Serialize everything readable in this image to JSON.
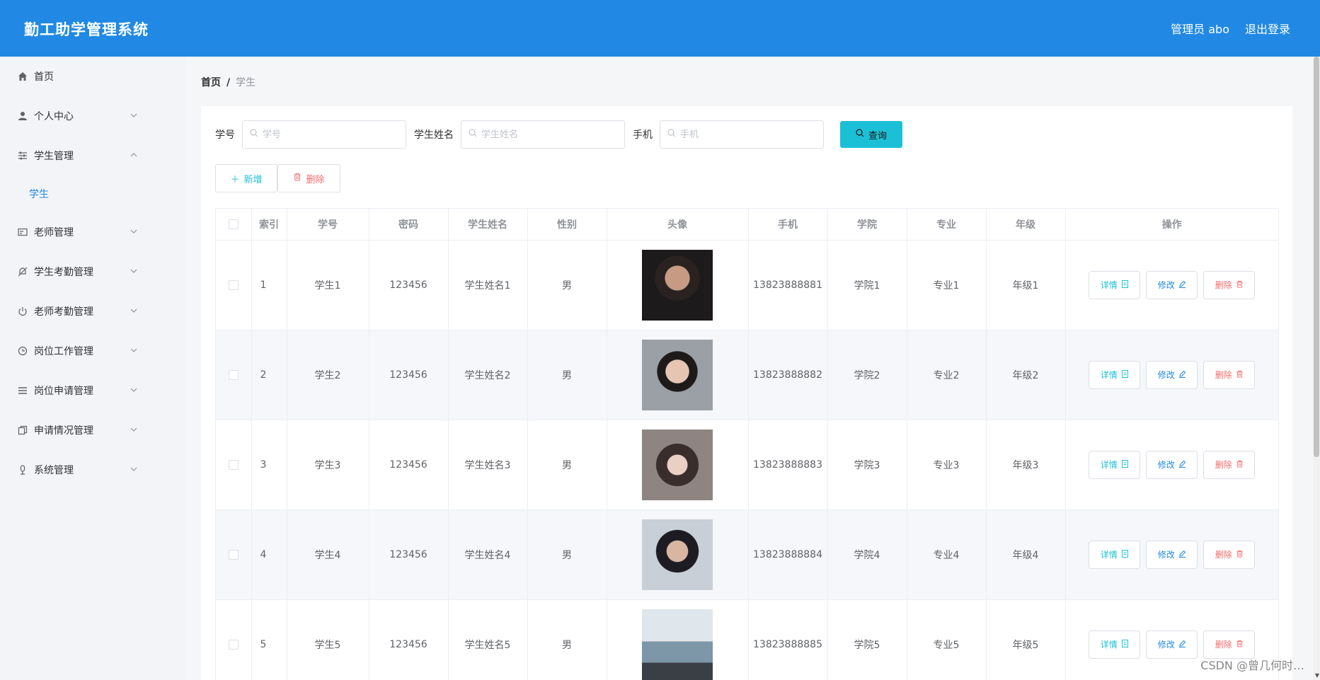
{
  "app": {
    "title": "勤工助学管理系统"
  },
  "header": {
    "user": "管理员 abo",
    "logout": "退出登录"
  },
  "sidebar": {
    "items": [
      {
        "label": "首页",
        "icon": "home-icon",
        "expandable": false
      },
      {
        "label": "个人中心",
        "icon": "user-icon",
        "expandable": true
      },
      {
        "label": "学生管理",
        "icon": "sliders-icon",
        "expandable": true,
        "expanded": true,
        "children": [
          {
            "label": "学生"
          }
        ]
      },
      {
        "label": "老师管理",
        "icon": "card-icon",
        "expandable": true
      },
      {
        "label": "学生考勤管理",
        "icon": "bell-off-icon",
        "expandable": true
      },
      {
        "label": "老师考勤管理",
        "icon": "power-icon",
        "expandable": true
      },
      {
        "label": "岗位工作管理",
        "icon": "clock-icon",
        "expandable": true
      },
      {
        "label": "岗位申请管理",
        "icon": "list-icon",
        "expandable": true
      },
      {
        "label": "申请情况管理",
        "icon": "copy-icon",
        "expandable": true
      },
      {
        "label": "系统管理",
        "icon": "mic-icon",
        "expandable": true
      }
    ]
  },
  "breadcrumb": {
    "home": "首页",
    "sep": "/",
    "current": "学生"
  },
  "search": {
    "fields": [
      {
        "label": "学号",
        "placeholder": "学号"
      },
      {
        "label": "学生姓名",
        "placeholder": "学生姓名"
      },
      {
        "label": "手机",
        "placeholder": "手机"
      }
    ],
    "query_label": "查询"
  },
  "actions": {
    "add_label": "新增",
    "delete_label": "删除"
  },
  "table": {
    "columns": [
      "索引",
      "学号",
      "密码",
      "学生姓名",
      "性别",
      "头像",
      "手机",
      "学院",
      "专业",
      "年级",
      "操作"
    ],
    "rows": [
      {
        "index": "1",
        "id": "学生1",
        "password": "123456",
        "name": "学生姓名1",
        "gender": "男",
        "phone": "13823888881",
        "college": "学院1",
        "major": "专业1",
        "grade": "年级1"
      },
      {
        "index": "2",
        "id": "学生2",
        "password": "123456",
        "name": "学生姓名2",
        "gender": "男",
        "phone": "13823888882",
        "college": "学院2",
        "major": "专业2",
        "grade": "年级2"
      },
      {
        "index": "3",
        "id": "学生3",
        "password": "123456",
        "name": "学生姓名3",
        "gender": "男",
        "phone": "13823888883",
        "college": "学院3",
        "major": "专业3",
        "grade": "年级3"
      },
      {
        "index": "4",
        "id": "学生4",
        "password": "123456",
        "name": "学生姓名4",
        "gender": "男",
        "phone": "13823888884",
        "college": "学院4",
        "major": "专业4",
        "grade": "年级4"
      },
      {
        "index": "5",
        "id": "学生5",
        "password": "123456",
        "name": "学生姓名5",
        "gender": "男",
        "phone": "13823888885",
        "college": "学院5",
        "major": "专业5",
        "grade": "年级5"
      }
    ],
    "row_actions": {
      "detail": "详情",
      "edit": "修改",
      "delete": "删除"
    }
  },
  "watermark": "CSDN @曾几何时…",
  "colors": {
    "header": "#2189e3",
    "accent": "#1cc0d6",
    "danger": "#f56c6c",
    "primary": "#2189e3"
  }
}
